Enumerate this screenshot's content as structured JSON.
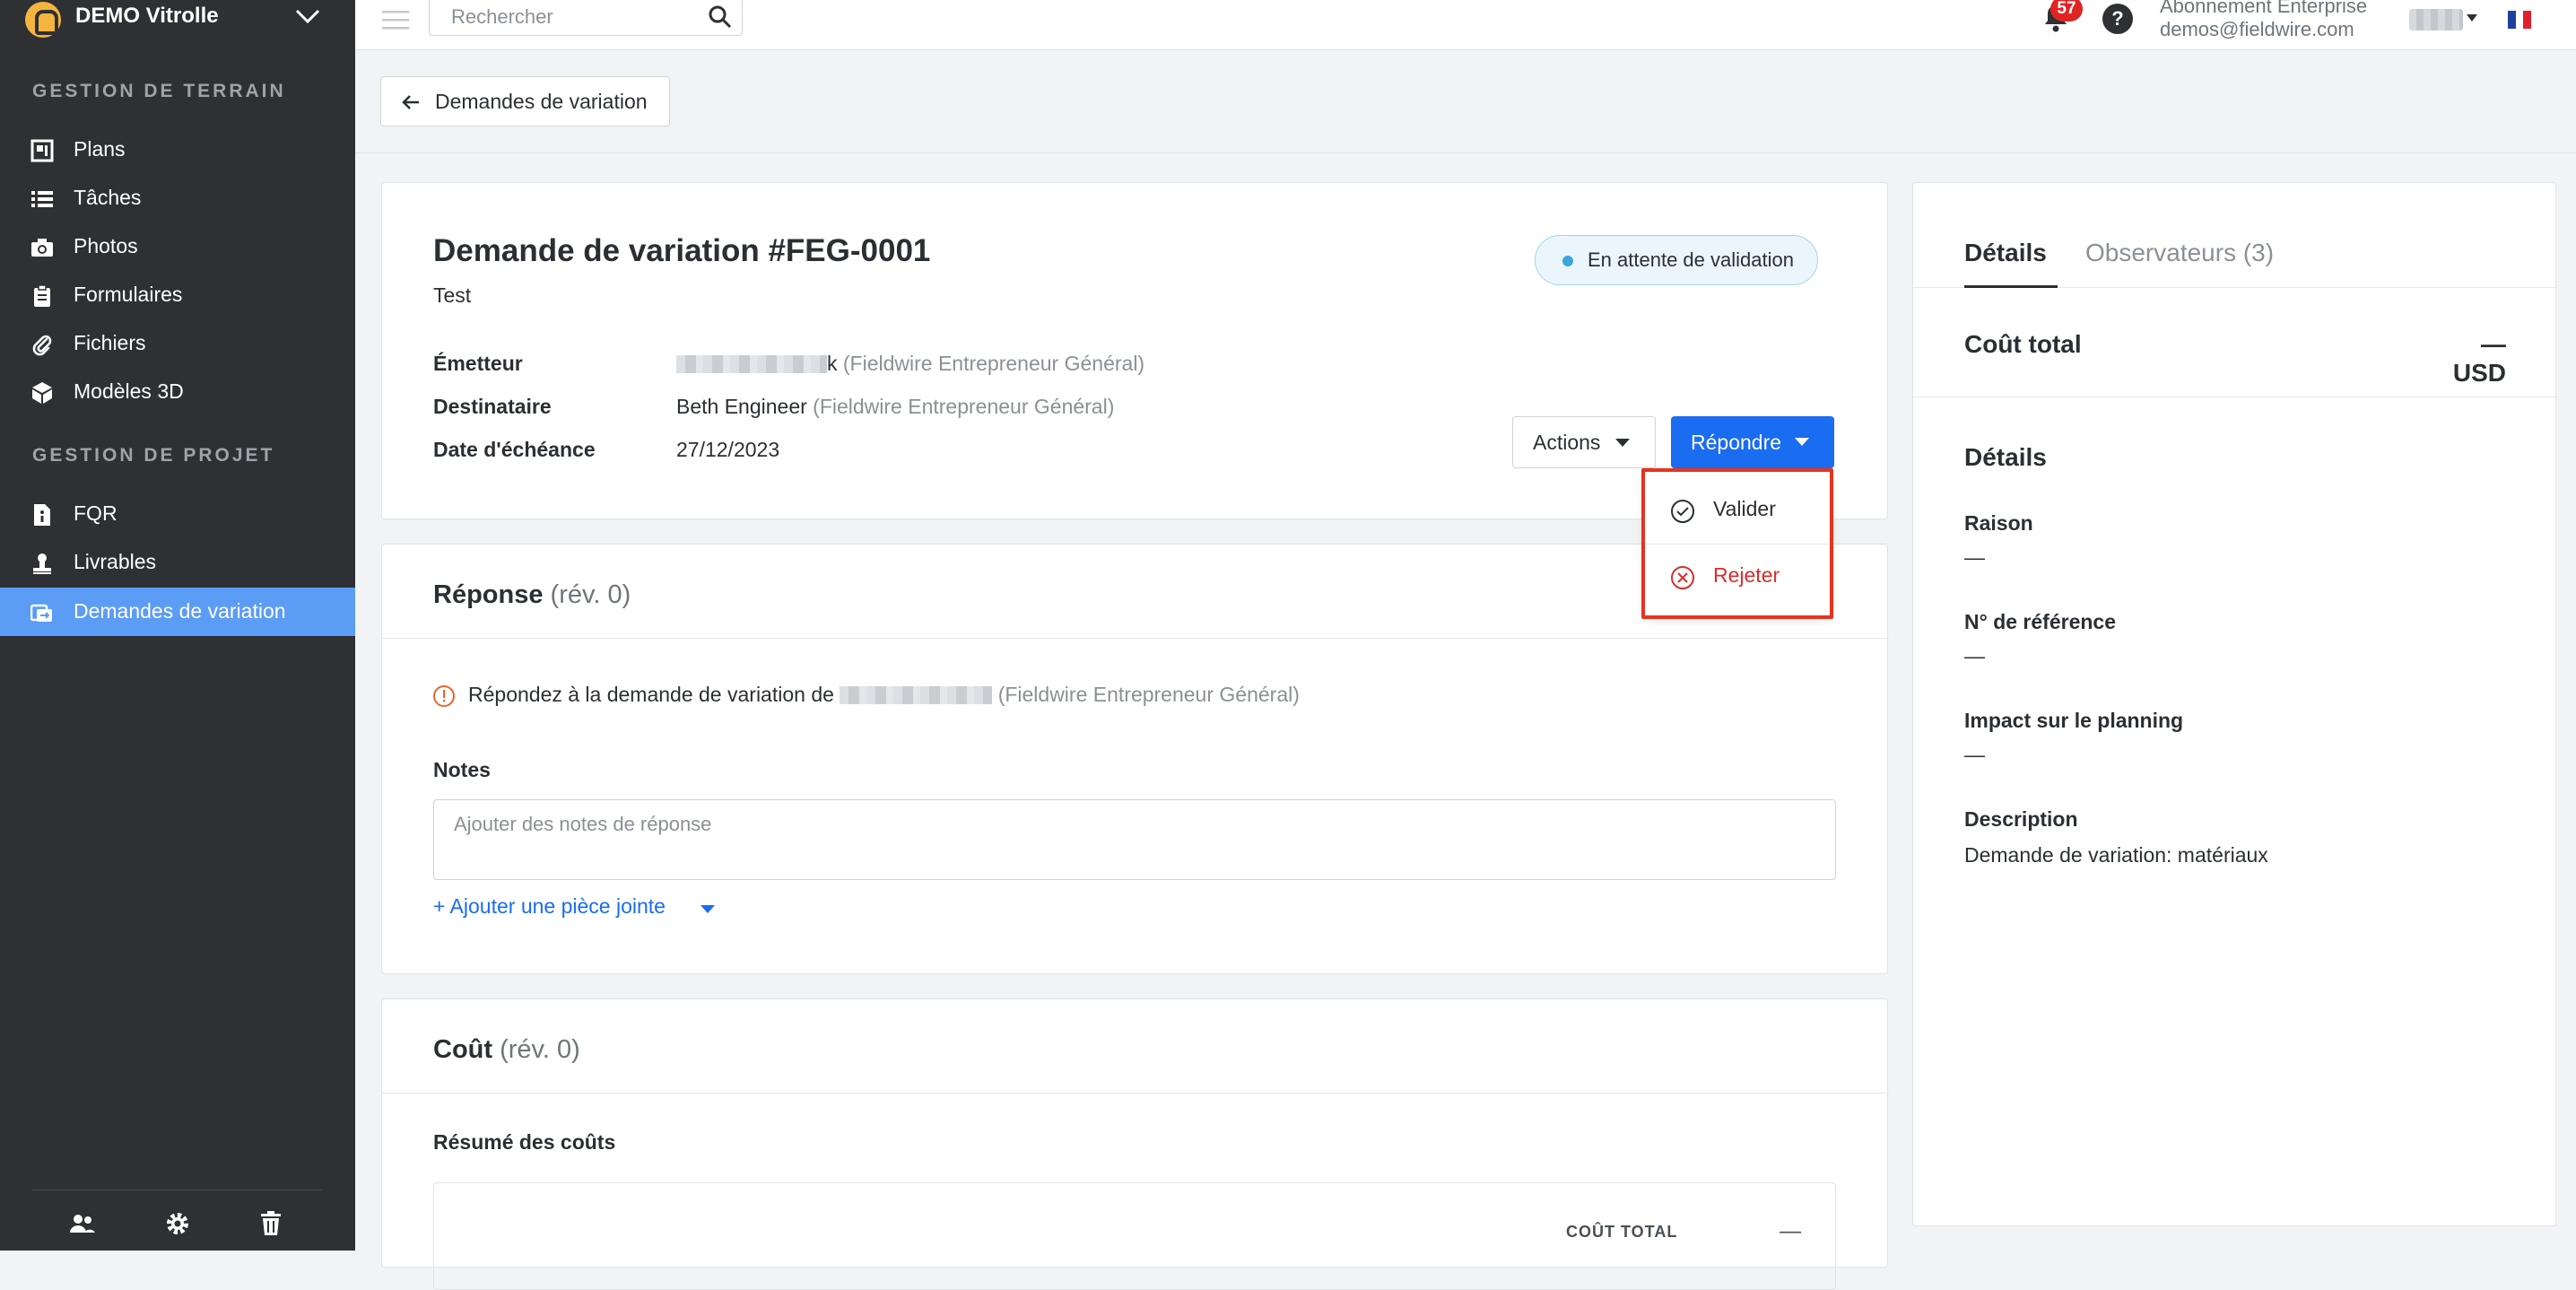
{
  "project": {
    "name": "DEMO Vitrolle"
  },
  "sidebar": {
    "field_section": "GESTION DE TERRAIN",
    "field_items": [
      {
        "label": "Plans",
        "icon": "plans-icon"
      },
      {
        "label": "Tâches",
        "icon": "tasks-icon"
      },
      {
        "label": "Photos",
        "icon": "camera-icon"
      },
      {
        "label": "Formulaires",
        "icon": "forms-icon"
      },
      {
        "label": "Fichiers",
        "icon": "paperclip-icon"
      },
      {
        "label": "Modèles 3D",
        "icon": "cube-icon"
      }
    ],
    "project_section": "GESTION DE PROJET",
    "project_items": [
      {
        "label": "FQR",
        "icon": "rfi-icon"
      },
      {
        "label": "Livrables",
        "icon": "submittal-icon"
      },
      {
        "label": "Demandes de variation",
        "icon": "change-order-icon",
        "active": true
      }
    ]
  },
  "topbar": {
    "search_placeholder": "Rechercher",
    "notifications": "57",
    "help": "?",
    "subscription": "Abonnement Enterprise",
    "email": "demos@fieldwire.com"
  },
  "back_button": "Demandes de variation",
  "change_order": {
    "title": "Demande de variation #FEG-0001",
    "subtitle": "Test",
    "status": "En attente de validation",
    "issuer_label": "Émetteur",
    "issuer_suffix": "k",
    "issuer_company": "(Fieldwire Entrepreneur Général)",
    "recipient_label": "Destinataire",
    "recipient_name": "Beth Engineer",
    "recipient_company": "(Fieldwire Entrepreneur Général)",
    "due_label": "Date d'échéance",
    "due_date": "27/12/2023",
    "actions_button": "Actions",
    "reply_button": "Répondre"
  },
  "reply_menu": {
    "approve": "Valider",
    "reject": "Rejeter"
  },
  "response": {
    "title": "Réponse",
    "rev": "(rév. 0)",
    "prompt": "Répondez à la demande de variation de",
    "prompt_company": "(Fieldwire Entrepreneur Général)",
    "notes_label": "Notes",
    "notes_placeholder": "Ajouter des notes de réponse",
    "attach_link": "+ Ajouter une pièce jointe"
  },
  "cost": {
    "title": "Coût",
    "rev": "(rév. 0)",
    "summary_label": "Résumé des coûts",
    "column_total": "COÛT TOTAL",
    "total_value": "—"
  },
  "details_panel": {
    "tab_details": "Détails",
    "tab_watchers": "Observateurs (3)",
    "total_label": "Coût total",
    "total_value": "— USD",
    "details_heading": "Détails",
    "reason_label": "Raison",
    "reason_value": "—",
    "ref_label": "N° de référence",
    "ref_value": "—",
    "schedule_label": "Impact sur le planning",
    "schedule_value": "—",
    "description_label": "Description",
    "description_value": "Demande de variation:  matériaux"
  },
  "colors": {
    "sidebar_bg": "#2e3033",
    "active_nav": "#5b9cf5",
    "primary": "#1a6cf0",
    "reject": "#d92c2c",
    "highlight": "#e5341f",
    "status_dot": "#3aa6dd"
  }
}
